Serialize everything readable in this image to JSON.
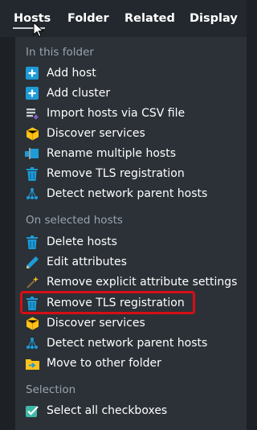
{
  "menubar": {
    "items": [
      "Hosts",
      "Folder",
      "Related",
      "Display"
    ],
    "active": "Hosts"
  },
  "sections": [
    {
      "title": "In this folder",
      "items": [
        {
          "label": "Add host",
          "icon": "add-host-icon"
        },
        {
          "label": "Add cluster",
          "icon": "add-cluster-icon"
        },
        {
          "label": "Import hosts via CSV file",
          "icon": "import-csv-icon"
        },
        {
          "label": "Discover services",
          "icon": "discover-services-icon"
        },
        {
          "label": "Rename multiple hosts",
          "icon": "rename-hosts-icon"
        },
        {
          "label": "Remove TLS registration",
          "icon": "trash-icon"
        },
        {
          "label": "Detect network parent hosts",
          "icon": "network-parents-icon"
        }
      ]
    },
    {
      "title": "On selected hosts",
      "items": [
        {
          "label": "Delete hosts",
          "icon": "trash-icon"
        },
        {
          "label": "Edit attributes",
          "icon": "pencil-icon"
        },
        {
          "label": "Remove explicit attribute settings",
          "icon": "wand-icon"
        },
        {
          "label": "Remove TLS registration",
          "icon": "trash-icon"
        },
        {
          "label": "Discover services",
          "icon": "discover-services-icon"
        },
        {
          "label": "Detect network parent hosts",
          "icon": "network-parents-icon"
        },
        {
          "label": "Move to other folder",
          "icon": "move-folder-icon"
        }
      ]
    },
    {
      "title": "Selection",
      "items": [
        {
          "label": "Select all checkboxes",
          "icon": "checkbox-icon"
        }
      ]
    }
  ],
  "colors": {
    "background": "#1d2126",
    "dropdown": "#2b3137",
    "section_title": "#9aa3ad",
    "highlight_border": "#d60f16",
    "accent_blue": "#1e9bd7",
    "accent_yellow": "#ffc31a"
  }
}
